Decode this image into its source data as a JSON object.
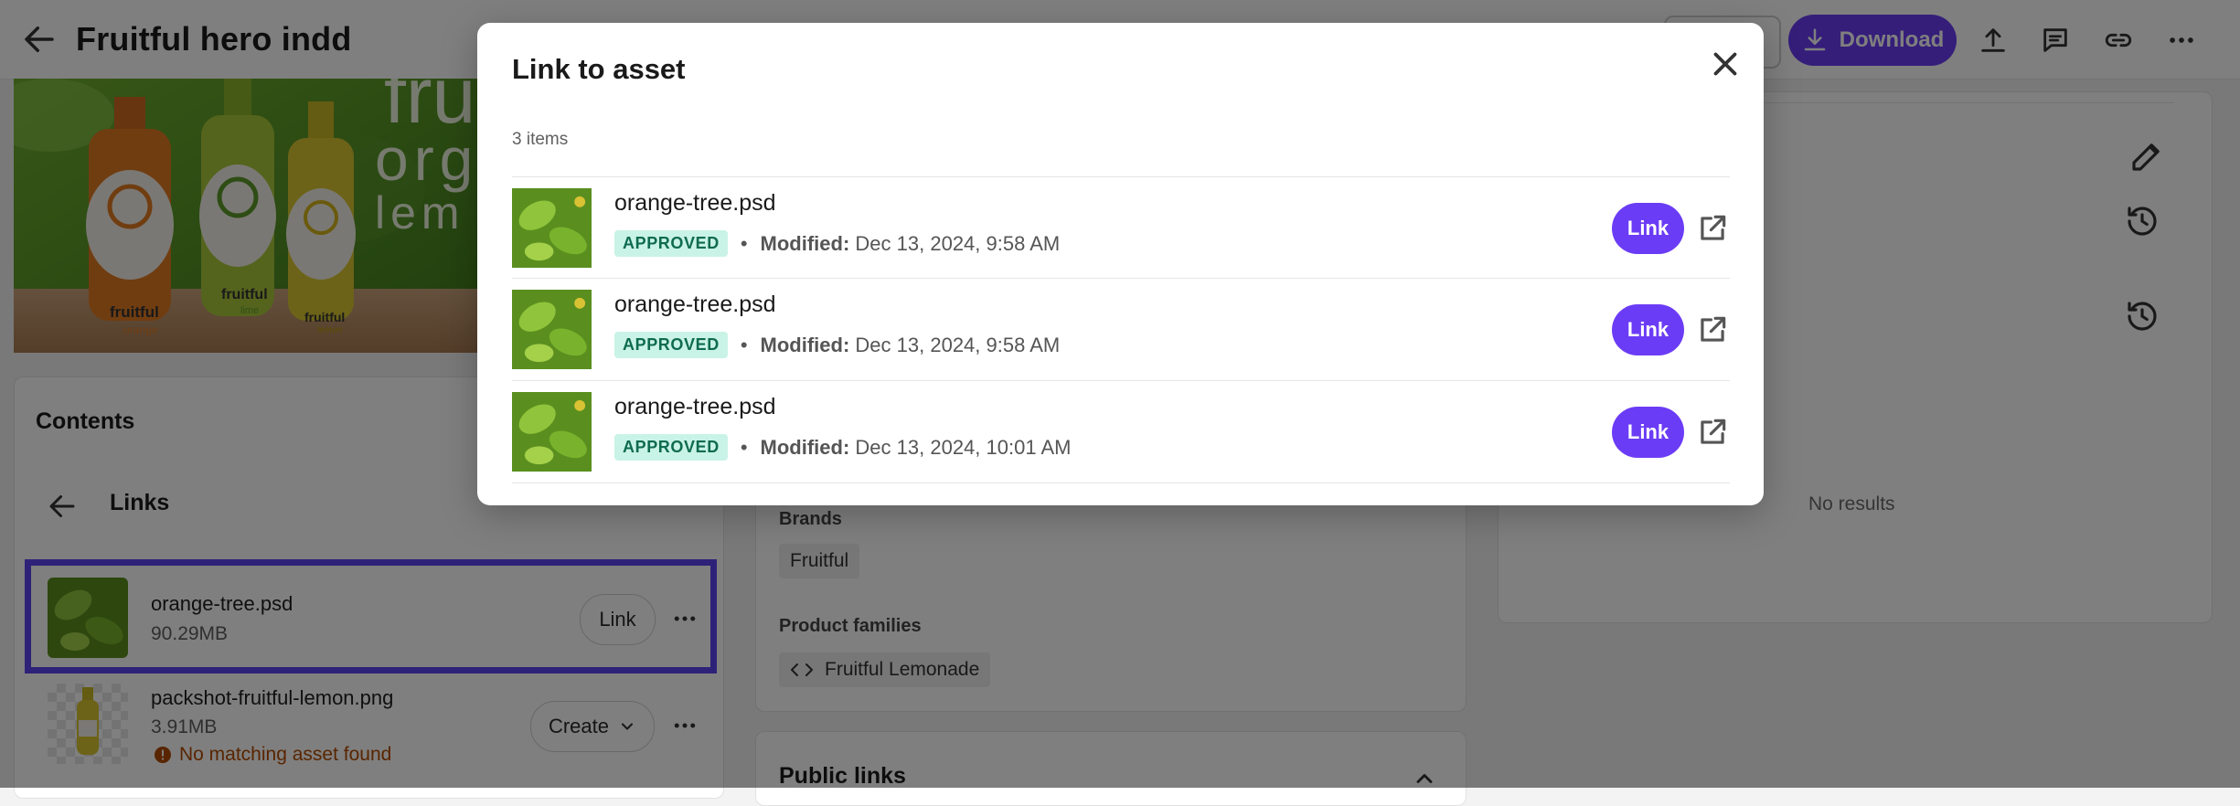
{
  "header": {
    "title": "Fruitful hero indd",
    "download_label": "Download"
  },
  "preview": {
    "bottle_labels": [
      "fruitful",
      "fruitful",
      "fruitful"
    ],
    "flavors": [
      "orange",
      "lime",
      "lemon"
    ],
    "banner_words": [
      "fru",
      "org",
      "lem"
    ]
  },
  "contents": {
    "title": "Contents",
    "links_title": "Links",
    "rows": [
      {
        "name": "orange-tree.psd",
        "size": "90.29MB",
        "action": "Link"
      },
      {
        "name": "packshot-fruitful-lemon.png",
        "size": "3.91MB",
        "action": "Create",
        "warning": "No matching asset found"
      }
    ]
  },
  "details": {
    "brands_label": "Brands",
    "brand_value": "Fruitful",
    "product_families_label": "Product families",
    "product_family_value": "Fruitful Lemonade",
    "public_links_title": "Public links"
  },
  "right_panel": {
    "no_results": "No results"
  },
  "modal": {
    "title": "Link to asset",
    "item_count": "3 items",
    "modified_label": "Modified:",
    "link_label": "Link",
    "items": [
      {
        "name": "orange-tree.psd",
        "status": "APPROVED",
        "modified": "Dec 13, 2024, 9:58 AM"
      },
      {
        "name": "orange-tree.psd",
        "status": "APPROVED",
        "modified": "Dec 13, 2024, 9:58 AM"
      },
      {
        "name": "orange-tree.psd",
        "status": "APPROVED",
        "modified": "Dec 13, 2024, 10:01 AM"
      }
    ]
  },
  "colors": {
    "accent": "#6b3cf5",
    "highlight": "#5b45f0",
    "approved_bg": "#c9f3e6",
    "approved_text": "#0f6b4f",
    "warning": "#b34a00"
  },
  "icons": [
    "back-arrow-icon",
    "download-icon",
    "upload-icon",
    "comment-icon",
    "link-icon",
    "more-icon",
    "close-icon",
    "external-link-icon",
    "pencil-icon",
    "history-icon",
    "chevron-down-icon",
    "chevron-up-icon",
    "code-icon",
    "warning-icon"
  ]
}
